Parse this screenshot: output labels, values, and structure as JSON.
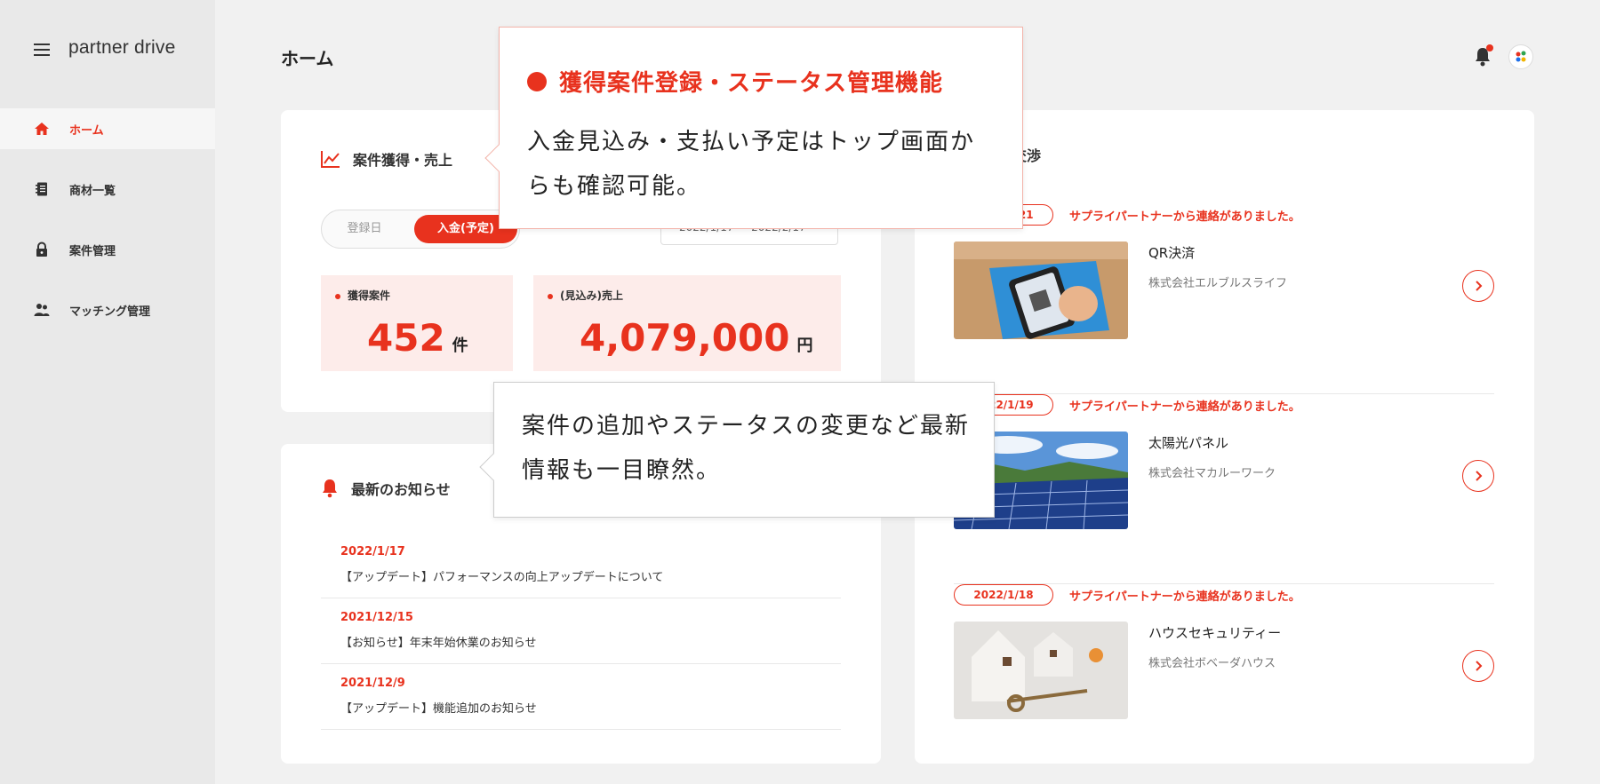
{
  "app": {
    "logo_text": "partner drive",
    "page_title": "ホーム"
  },
  "sidebar": {
    "items": [
      {
        "label": "ホーム",
        "icon": "home-icon",
        "active": true
      },
      {
        "label": "商材一覧",
        "icon": "notebook-icon",
        "active": false
      },
      {
        "label": "案件管理",
        "icon": "lock-icon",
        "active": false
      },
      {
        "label": "マッチング管理",
        "icon": "people-icon",
        "active": false
      }
    ]
  },
  "sales_card": {
    "title": "案件獲得・売上",
    "toggle": {
      "off_label": "登録日",
      "on_label": "入金(予定)"
    },
    "period_label": "期間",
    "period_value": "2022/1/17 〜 2022/2/17",
    "stats": [
      {
        "label": "獲得案件",
        "value": "452",
        "unit": "件"
      },
      {
        "label": "(見込み)売上",
        "value": "4,079,000",
        "unit": "円"
      }
    ]
  },
  "news_card": {
    "title": "最新のお知らせ",
    "items": [
      {
        "date": "2022/1/17",
        "text": "【アップデート】パフォーマンスの向上アップデートについて"
      },
      {
        "date": "2021/12/15",
        "text": "【お知らせ】年末年始休業のお知らせ"
      },
      {
        "date": "2021/12/9",
        "text": "【アップデート】機能追加のお知らせ"
      }
    ]
  },
  "nego_card": {
    "title": "交渉",
    "items": [
      {
        "date": "2022/1/21",
        "message": "サプライパートナーから連絡がありました。",
        "name": "QR決済",
        "company": "株式会社エルブルスライフ"
      },
      {
        "date": "2022/1/19",
        "message": "サプライパートナーから連絡がありました。",
        "name": "太陽光パネル",
        "company": "株式会社マカルーワーク"
      },
      {
        "date": "2022/1/18",
        "message": "サプライパートナーから連絡がありました。",
        "name": "ハウスセキュリティー",
        "company": "株式会社ボベーダハウス"
      }
    ]
  },
  "callouts": {
    "first": {
      "title": "獲得案件登録・ステータス管理機能",
      "body": "入金見込み・支払い予定はトップ画面からも確認可能。"
    },
    "second": {
      "body": "案件の追加やステータスの変更など最新情報も一目瞭然。"
    }
  },
  "colors": {
    "accent": "#e8321e",
    "stat_bg": "#fdecea",
    "sidebar_bg": "#e9e9e9"
  }
}
